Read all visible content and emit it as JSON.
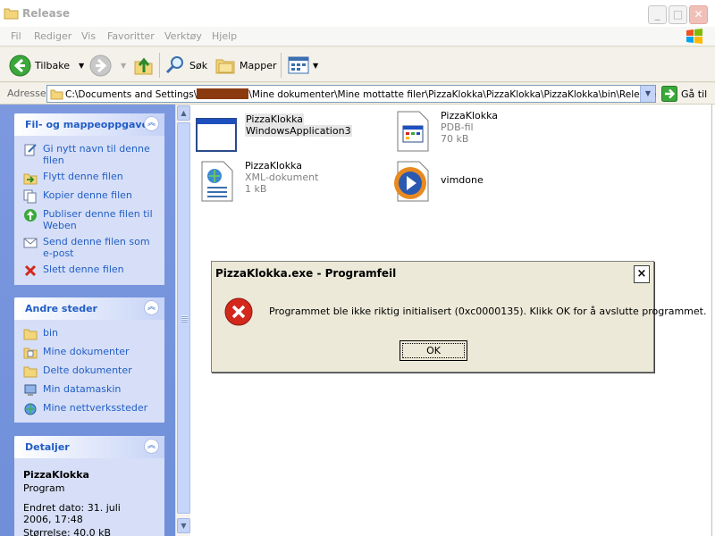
{
  "window": {
    "title": "Release"
  },
  "menu": [
    "Fil",
    "Rediger",
    "Vis",
    "Favoritter",
    "Verktøy",
    "Hjelp"
  ],
  "toolbar": {
    "back": "Tilbake",
    "search": "Søk",
    "folders": "Mapper"
  },
  "address": {
    "label": "Adresse",
    "path_start": "C:\\Documents and Settings\\",
    "path_end": "\\Mine dokumenter\\Mine mottatte filer\\PizzaKlokka\\PizzaKlokka\\PizzaKlokka\\bin\\Release",
    "go": "Gå til"
  },
  "tasks_panel": {
    "title": "Fil- og mappeoppgaver",
    "items": [
      "Gi nytt navn til denne filen",
      "Flytt denne filen",
      "Kopier denne filen",
      "Publiser denne filen til Weben",
      "Send denne filen som e-post",
      "Slett denne filen"
    ]
  },
  "places_panel": {
    "title": "Andre steder",
    "items": [
      "bin",
      "Mine dokumenter",
      "Delte dokumenter",
      "Min datamaskin",
      "Mine nettverkssteder"
    ]
  },
  "details_panel": {
    "title": "Detaljer",
    "name": "PizzaKlokka",
    "type": "Program",
    "modified": "Endret dato: 31. juli 2006, 17:48",
    "size": "Størrelse: 40,0 kB"
  },
  "files": [
    {
      "name": "PizzaKlokka",
      "sub": "WindowsApplication3",
      "sub2": ""
    },
    {
      "name": "PizzaKlokka",
      "sub": "PDB-fil",
      "sub2": "70 kB"
    },
    {
      "name": "PizzaKlokka",
      "sub": "XML-dokument",
      "sub2": "1 kB"
    },
    {
      "name": "vimdone",
      "sub": "",
      "sub2": ""
    }
  ],
  "dialog": {
    "title": "PizzaKlokka.exe - Programfeil",
    "message": "Programmet ble ikke riktig initialisert (0xc0000135). Klikk OK for å avslutte programmet.",
    "ok": "OK",
    "close": "×"
  },
  "colors": {
    "task_link": "#215dc6",
    "pane_bg": "#7a96df",
    "error_red": "#d4281c"
  }
}
